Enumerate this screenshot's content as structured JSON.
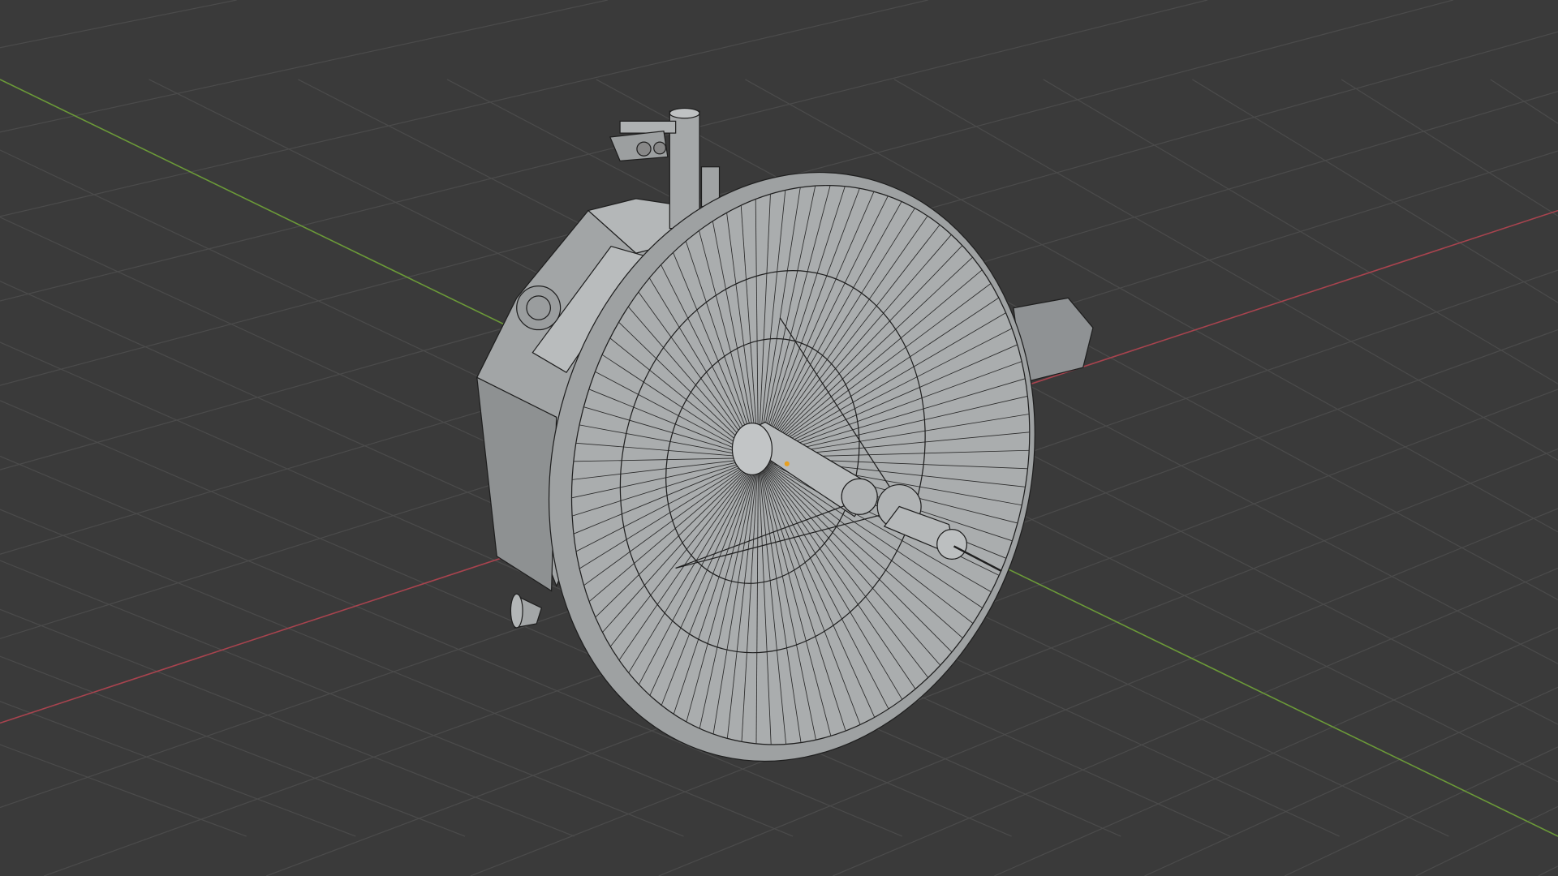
{
  "viewport": {
    "background_color": "#3a3a3a",
    "grid_color": "#4a4a4a",
    "x_axis_color": "#b5444f",
    "y_axis_color": "#6e9a3a",
    "mesh_fill": "#a9acad",
    "wire_color": "#1c1c1c"
  },
  "model": {
    "dish_segments": 96,
    "icon": "satellite-dish-model"
  }
}
